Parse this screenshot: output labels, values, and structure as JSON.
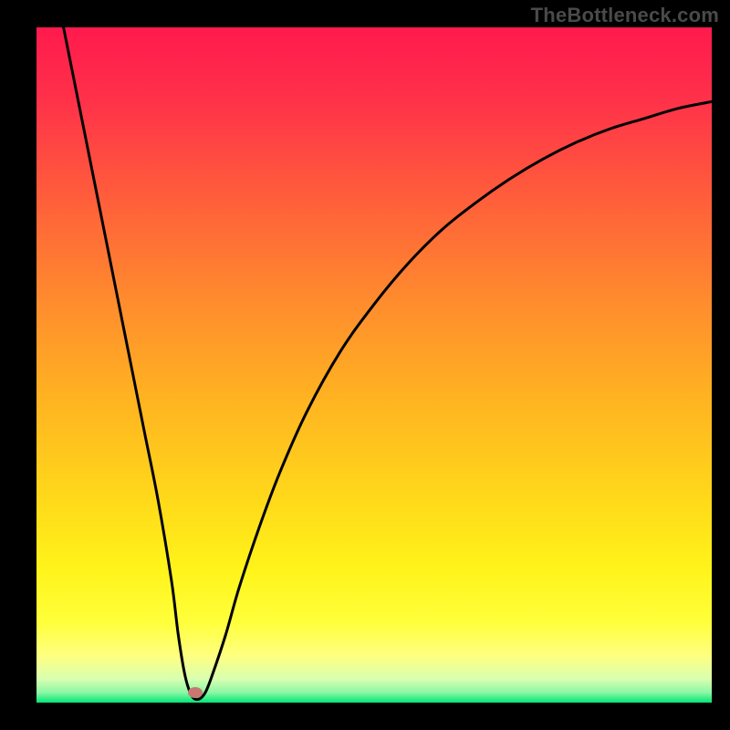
{
  "watermark": "TheBottleneck.com",
  "gradient_stops": [
    {
      "offset": 0.0,
      "color": "#ff1a4d"
    },
    {
      "offset": 0.1,
      "color": "#ff2f4a"
    },
    {
      "offset": 0.24,
      "color": "#ff5a3c"
    },
    {
      "offset": 0.4,
      "color": "#ff8a2e"
    },
    {
      "offset": 0.55,
      "color": "#ffb321"
    },
    {
      "offset": 0.7,
      "color": "#ffd91a"
    },
    {
      "offset": 0.8,
      "color": "#fff31a"
    },
    {
      "offset": 0.88,
      "color": "#ffff3a"
    },
    {
      "offset": 0.93,
      "color": "#ffff80"
    },
    {
      "offset": 0.965,
      "color": "#d9ffb0"
    },
    {
      "offset": 0.985,
      "color": "#8cf7a4"
    },
    {
      "offset": 1.0,
      "color": "#00e676"
    }
  ],
  "marker": {
    "x_frac": 0.235,
    "y_frac": 0.985,
    "color": "#c87870"
  },
  "chart_data": {
    "type": "line",
    "title": "",
    "xlabel": "",
    "ylabel": "",
    "xlim": [
      0,
      100
    ],
    "ylim": [
      0,
      100
    ],
    "series": [
      {
        "name": "bottleneck-curve",
        "x": [
          4,
          6,
          8,
          10,
          12,
          14,
          16,
          18,
          20,
          21,
          22,
          23,
          24,
          25,
          26,
          28,
          30,
          33,
          36,
          40,
          45,
          50,
          55,
          60,
          65,
          70,
          75,
          80,
          85,
          90,
          95,
          100
        ],
        "y": [
          100,
          90,
          80,
          70,
          60,
          50,
          40,
          30,
          18,
          10,
          4,
          1,
          0.5,
          1.5,
          4,
          10,
          17,
          26,
          34,
          43,
          52,
          59,
          65,
          70,
          74,
          77.5,
          80.5,
          83,
          85,
          86.5,
          88,
          89
        ]
      }
    ],
    "annotations": [
      {
        "type": "marker",
        "x": 23.5,
        "y": 1.5,
        "label": "optimal-point"
      }
    ],
    "background": "vertical-gradient red→orange→yellow→green (bottleneck severity)"
  }
}
